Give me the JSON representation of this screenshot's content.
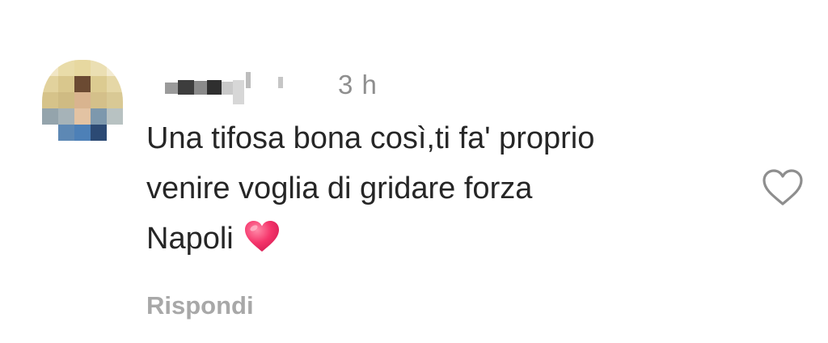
{
  "comment": {
    "timestamp": "3 h",
    "text_lines": [
      "Una tifosa bona così,ti fa' proprio",
      "venire voglia di gridare forza",
      "Napoli"
    ],
    "emoji": "red-heart-emoji",
    "reply_label": "Rispondi",
    "like_icon": "heart-outline-icon",
    "avatar_icon": "blurred-avatar",
    "username": "blurred-username"
  },
  "colors": {
    "text": "#262626",
    "muted": "#8e8e8e",
    "reply": "#a8a8a8",
    "heart_emoji": "#f5356b",
    "like_icon": "#8e8e8e"
  }
}
